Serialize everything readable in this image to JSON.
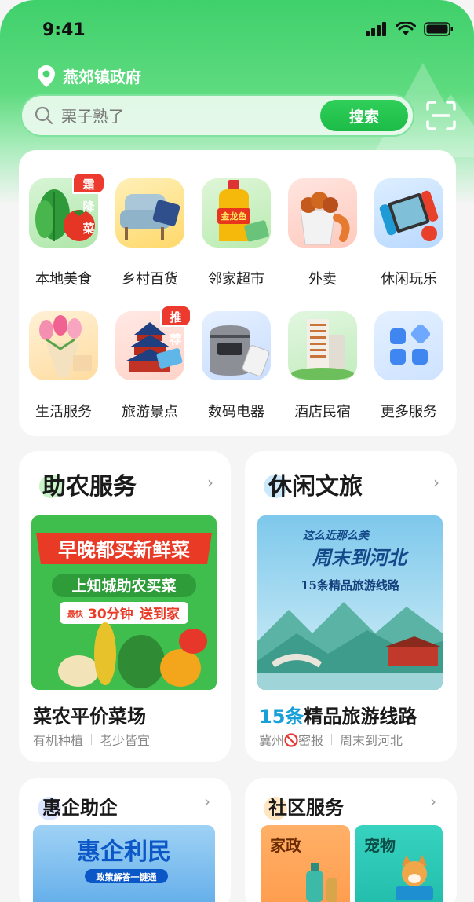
{
  "status": {
    "time": "9:41"
  },
  "location": {
    "name": "燕郊镇政府",
    "icon": "location-pin-icon"
  },
  "search": {
    "placeholder": "栗子熟了",
    "button_label": "搜索"
  },
  "grid": {
    "items": [
      {
        "label": "本地美食",
        "tag": "霜降菜",
        "icon": "vegetables-icon"
      },
      {
        "label": "乡村百货",
        "tag": "",
        "icon": "armchair-icon"
      },
      {
        "label": "邻家超市",
        "tag": "",
        "icon": "cooking-oil-icon",
        "icon_text": "金龙鱼"
      },
      {
        "label": "外卖",
        "tag": "",
        "icon": "fried-chicken-icon"
      },
      {
        "label": "休闲玩乐",
        "tag": "",
        "icon": "game-console-icon"
      },
      {
        "label": "生活服务",
        "tag": "",
        "icon": "flowers-icon"
      },
      {
        "label": "旅游景点",
        "tag": "推荐",
        "icon": "temple-icon"
      },
      {
        "label": "数码电器",
        "tag": "",
        "icon": "rice-cooker-icon"
      },
      {
        "label": "酒店民宿",
        "tag": "",
        "icon": "hotel-building-icon"
      },
      {
        "label": "更多服务",
        "tag": "",
        "icon": "more-grid-icon"
      }
    ]
  },
  "agri": {
    "title": "助农服务",
    "banner": {
      "line1": "早晚都买新鲜菜",
      "line2": "上知城助农买菜",
      "fast": "最快",
      "minutes": "30分钟",
      "delivery": "送到家"
    },
    "name": "菜农平价菜场",
    "tags": [
      "有机种植",
      "老少皆宜"
    ]
  },
  "tour": {
    "title": "休闲文旅",
    "banner": {
      "line1": "这么近那么美",
      "line2": "周末到河北",
      "line3": "15条精品旅游线路"
    },
    "name_highlight": "15条",
    "name_rest": "精品旅游线路",
    "name_color": "#1aa0d8",
    "tag1_pre": "冀州",
    "tag1_post": "密报",
    "tag2": "周末到河北"
  },
  "biz": {
    "title": "惠企助企",
    "banner": {
      "line1": "惠企利民",
      "line2": "政策解答一键通"
    }
  },
  "community": {
    "title": "社区服务",
    "tiles": [
      {
        "label": "家政"
      },
      {
        "label": "宠物"
      }
    ]
  },
  "colors": {
    "brand_green": "#2fcf59",
    "tag_red": "#ec3a2f"
  }
}
